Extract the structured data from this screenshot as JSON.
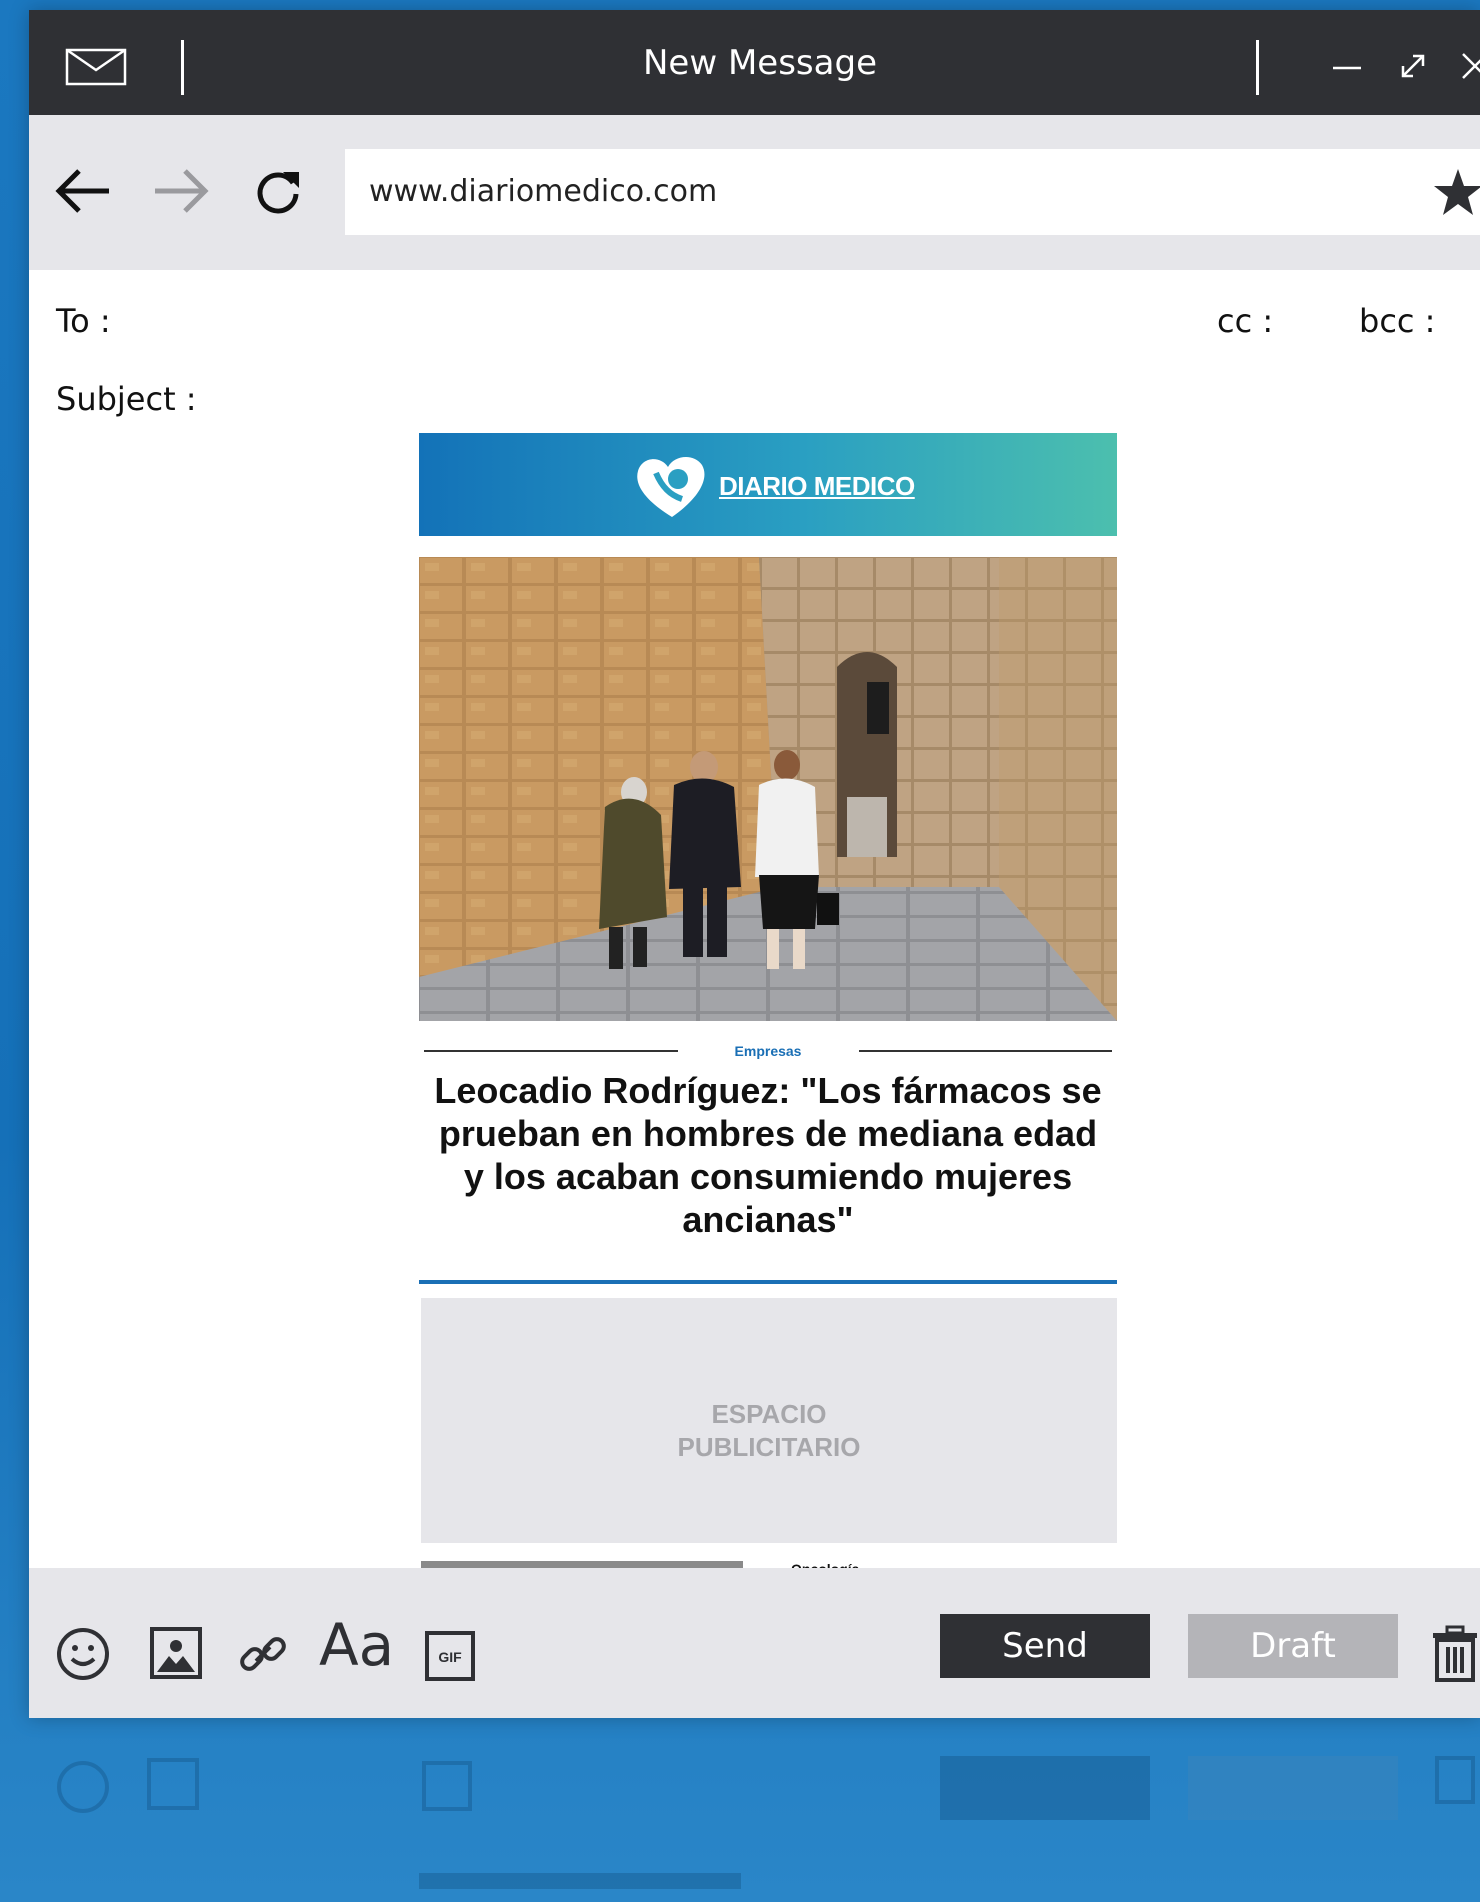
{
  "window": {
    "title": "New Message",
    "controls": [
      "minimize",
      "maximize",
      "close"
    ]
  },
  "browser": {
    "url": "www.diariomedico.com"
  },
  "compose": {
    "to_label": "To :",
    "cc_label": "cc :",
    "bcc_label": "bcc :",
    "subject_label": "Subject :"
  },
  "email": {
    "brand": "DIARIO MEDICO",
    "section": "Empresas",
    "headline": "Leocadio Rodríguez: \"Los fármacos se prueban en hombres de mediana edad y los acaban consumiendo mujeres ancianas\"",
    "ad_line1": "ESPACIO",
    "ad_line2": "PUBLICITARIO",
    "next_section": "Oncología"
  },
  "toolbar": {
    "font_label": "Aa",
    "gif_label": "GIF",
    "send_label": "Send",
    "draft_label": "Draft"
  },
  "colors": {
    "titlebar": "#2f3034",
    "panel": "#e6e6ea",
    "accent_blue": "#1a6fb5",
    "banner_start": "#1372b8",
    "banner_end": "#4cbfae"
  }
}
